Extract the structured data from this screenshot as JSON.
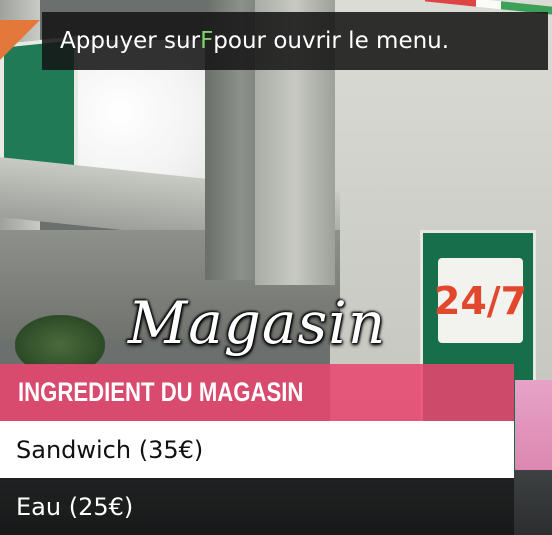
{
  "help_notification": {
    "prefix": "Appuyer sur ",
    "key": "F",
    "suffix": " pour ouvrir le menu."
  },
  "menu": {
    "title": "Magasin",
    "subtitle": "INGREDIENT DU MAGASIN",
    "items": [
      {
        "label": "Sandwich (35€)",
        "selected": true
      },
      {
        "label": "Eau (25€)",
        "selected": false
      }
    ]
  },
  "colors": {
    "subtitle_bg": "#e84670",
    "help_key": "#7dd36c",
    "selected_bg": "#ffffff"
  }
}
